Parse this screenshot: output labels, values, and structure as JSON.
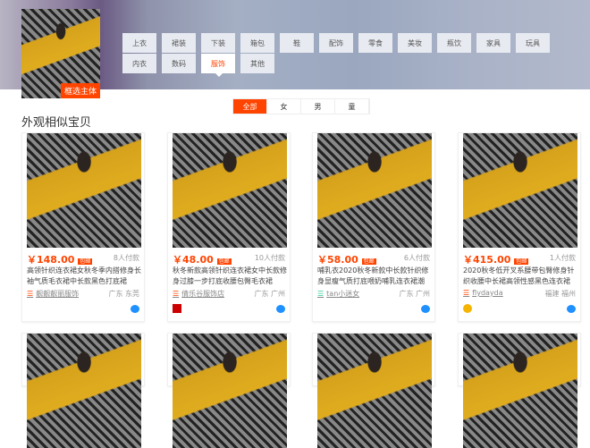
{
  "header": {
    "thumb_tag": "框选主体"
  },
  "categories": [
    "上衣",
    "裙装",
    "下装",
    "箱包",
    "鞋",
    "配饰",
    "零食",
    "美妆",
    "瓶饮",
    "家具",
    "玩具",
    "内衣",
    "数码",
    "服饰",
    "其他"
  ],
  "active_category": "服饰",
  "tabs": [
    "全部",
    "女",
    "男",
    "童"
  ],
  "active_tab": "全部",
  "section_title": "外观相似宝贝",
  "free_shipping": "包邮",
  "products": [
    {
      "price": "￥148.00",
      "sales": "8人付款",
      "desc": "高领针织连衣裙女秋冬季内搭修身长袖气质毛衣裙中长款黑色打底裙",
      "shop": "靓靓靓丽服饰",
      "location": "广东 东莞"
    },
    {
      "price": "￥48.00",
      "sales": "10人付款",
      "desc": "秋冬新款高领针织连衣裙女中长款修身过膝一步打底收腰包臀毛衣裙",
      "shop": "倩乐谷服饰店",
      "location": "广东 广州"
    },
    {
      "price": "￥58.00",
      "sales": "6人付款",
      "desc": "哺乳衣2020秋冬新款中长款针织修身显瘦气质打底喂奶哺乳连衣裙潮",
      "shop": "tan小迷女",
      "location": "广东 广州"
    },
    {
      "price": "￥415.00",
      "sales": "1人付款",
      "desc": "2020秋冬低开叉系腰带包臀修身针织收腰中长裙高领性感黑色连衣裙",
      "shop": "flydayda",
      "location": "福建 福州"
    }
  ],
  "colors": {
    "accent": "#ff4400",
    "wangwang": "#1e90ff"
  }
}
